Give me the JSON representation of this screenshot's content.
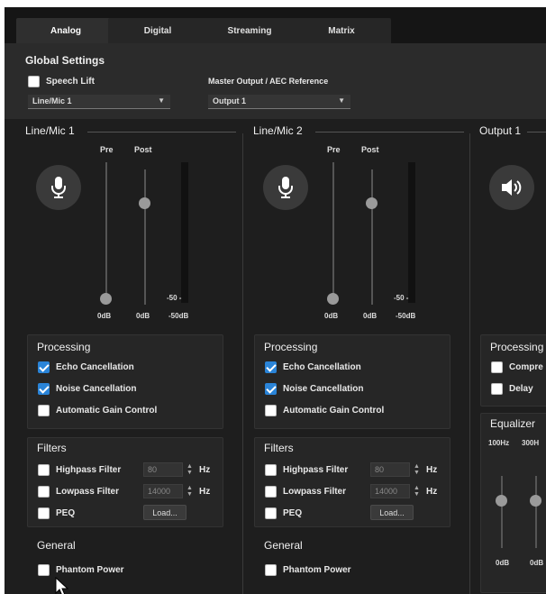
{
  "tabs": [
    "Analog",
    "Digital",
    "Streaming",
    "Matrix"
  ],
  "global": {
    "title": "Global Settings",
    "speech_lift": "Speech Lift",
    "master_label": "Master Output / AEC Reference",
    "input_select": "Line/Mic 1",
    "output_select": "Output 1"
  },
  "channels": [
    {
      "title": "Line/Mic 1",
      "pre": "Pre",
      "post": "Post",
      "pre_val": "0dB",
      "post_val": "0dB",
      "meter_min": "-50dB",
      "meter_mark": "-50 -",
      "processing": "Processing",
      "echo": "Echo Cancellation",
      "noise": "Noise Cancellation",
      "agc": "Automatic Gain Control",
      "filters": "Filters",
      "highpass": "Highpass Filter",
      "hp_val": "80",
      "lowpass": "Lowpass Filter",
      "lp_val": "14000",
      "hz": "Hz",
      "peq": "PEQ",
      "load": "Load...",
      "general": "General",
      "phantom": "Phantom Power"
    },
    {
      "title": "Line/Mic 2",
      "pre": "Pre",
      "post": "Post",
      "pre_val": "0dB",
      "post_val": "0dB",
      "meter_min": "-50dB",
      "meter_mark": "-50 -",
      "processing": "Processing",
      "echo": "Echo Cancellation",
      "noise": "Noise Cancellation",
      "agc": "Automatic Gain Control",
      "filters": "Filters",
      "highpass": "Highpass Filter",
      "hp_val": "80",
      "lowpass": "Lowpass Filter",
      "lp_val": "14000",
      "hz": "Hz",
      "peq": "PEQ",
      "load": "Load...",
      "general": "General",
      "phantom": "Phantom Power"
    }
  ],
  "output": {
    "title": "Output 1",
    "processing": "Processing",
    "compressor": "Compre",
    "delay": "Delay",
    "equalizer": "Equalizer",
    "eq_band1": "100Hz",
    "eq_band2": "300H",
    "eq_val1": "0dB",
    "eq_val2": "0dB"
  },
  "colors": {
    "panel": "#1e1e1e",
    "accent": "#2a84d8"
  }
}
